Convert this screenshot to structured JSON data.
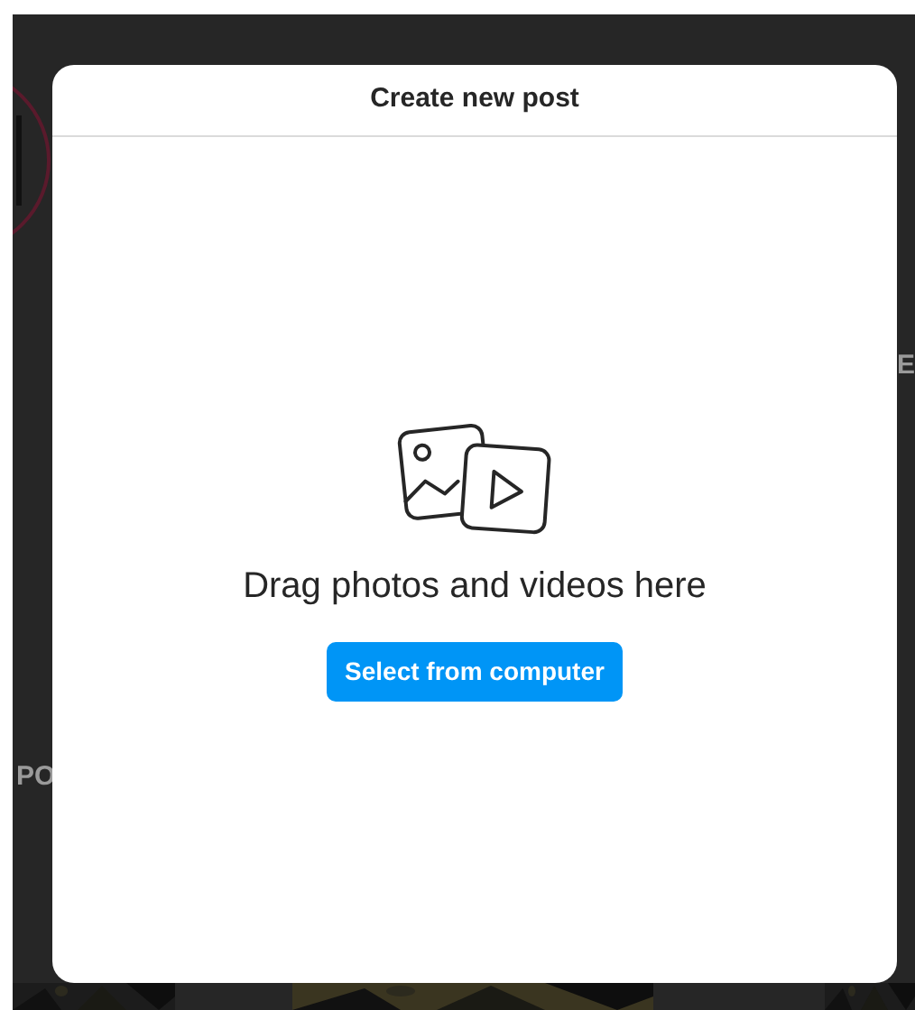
{
  "backdrop": {
    "texts": [
      {
        "text": "PO",
        "kind": "left"
      },
      {
        "text": "E",
        "kind": "right"
      }
    ]
  },
  "modal": {
    "title": "Create new post",
    "message": "Drag photos and videos here",
    "button": "Select from computer"
  }
}
